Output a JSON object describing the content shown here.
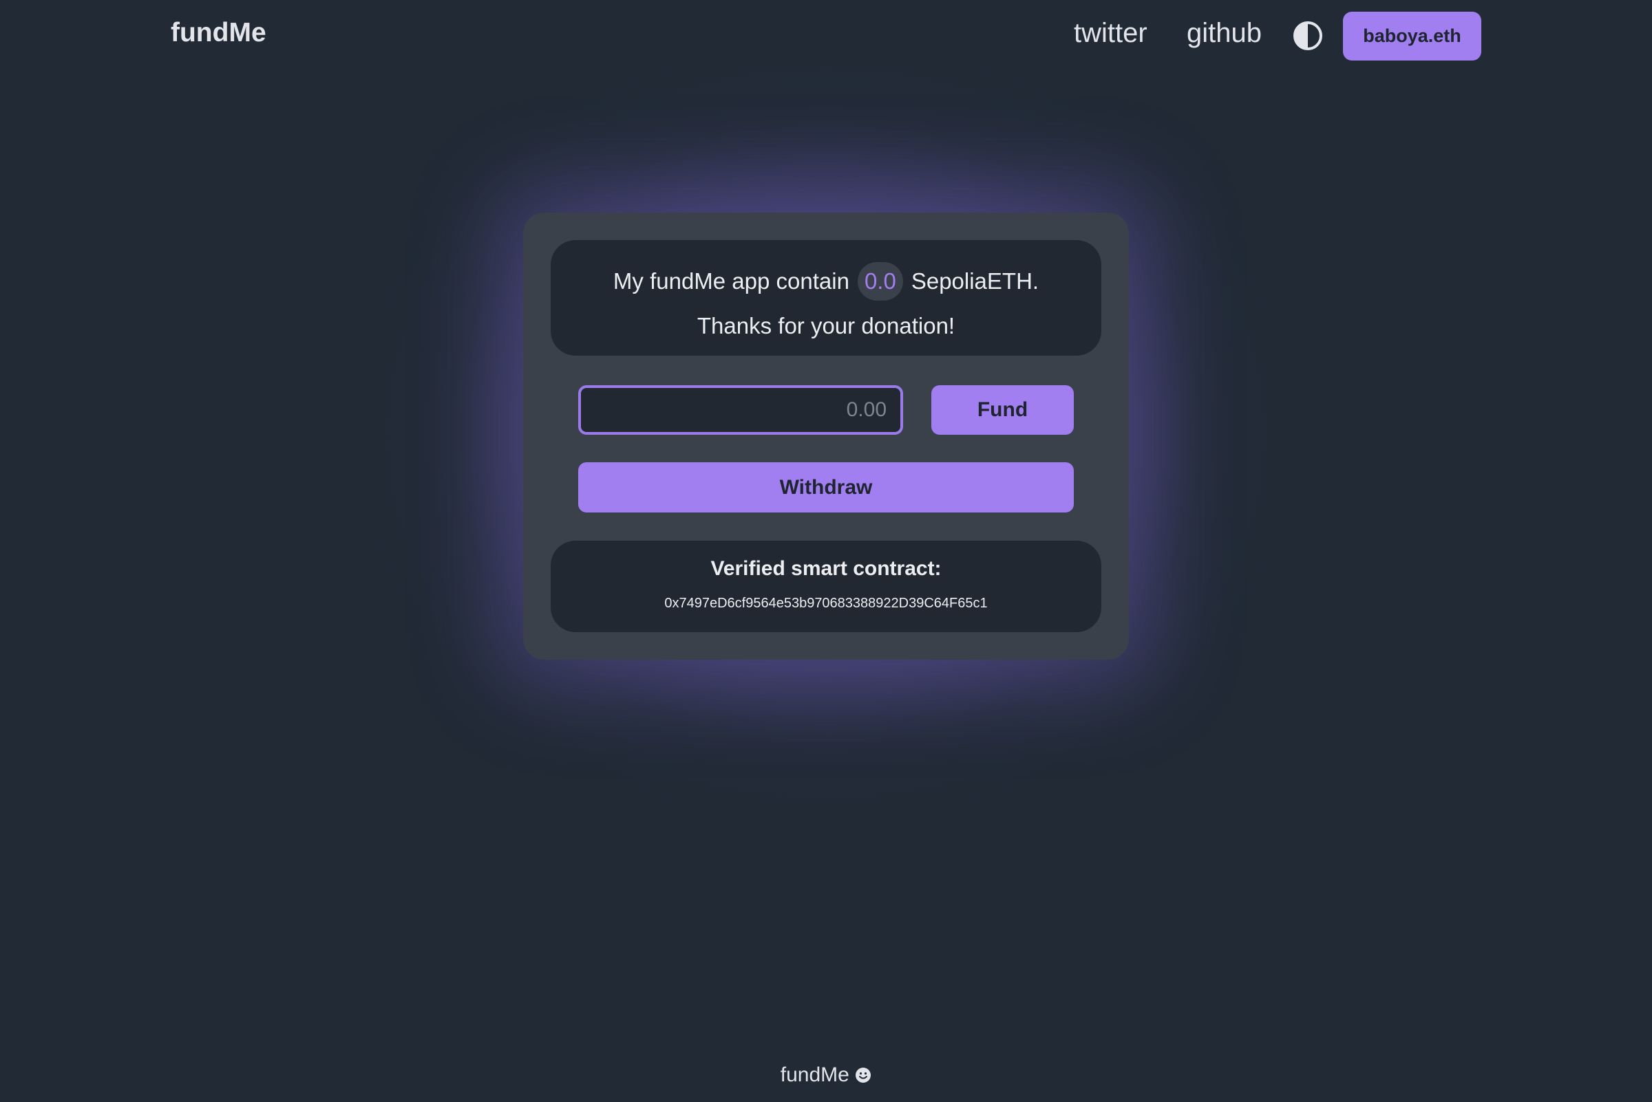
{
  "header": {
    "logo": "fundMe",
    "nav": {
      "twitter": "twitter",
      "github": "github"
    },
    "theme_toggle_icon": "half-circle-contrast-icon",
    "wallet_label": "baboya.eth"
  },
  "card": {
    "info": {
      "text_before": "My fundMe app contain",
      "balance": "0.0",
      "text_after": "SepoliaETH.",
      "thanks": "Thanks for your donation!"
    },
    "amount_input": {
      "value": "",
      "placeholder": "0.00"
    },
    "fund_label": "Fund",
    "withdraw_label": "Withdraw",
    "contract": {
      "title": "Verified smart contract:",
      "address": "0x7497eD6cf9564e53b970683388922D39C64F65c1"
    }
  },
  "footer": {
    "text": "fundMe",
    "icon": "smiley-icon"
  },
  "colors": {
    "background": "#212a35",
    "accent": "#a17ff0",
    "card": "#3a414b",
    "inner_box": "#212831"
  }
}
